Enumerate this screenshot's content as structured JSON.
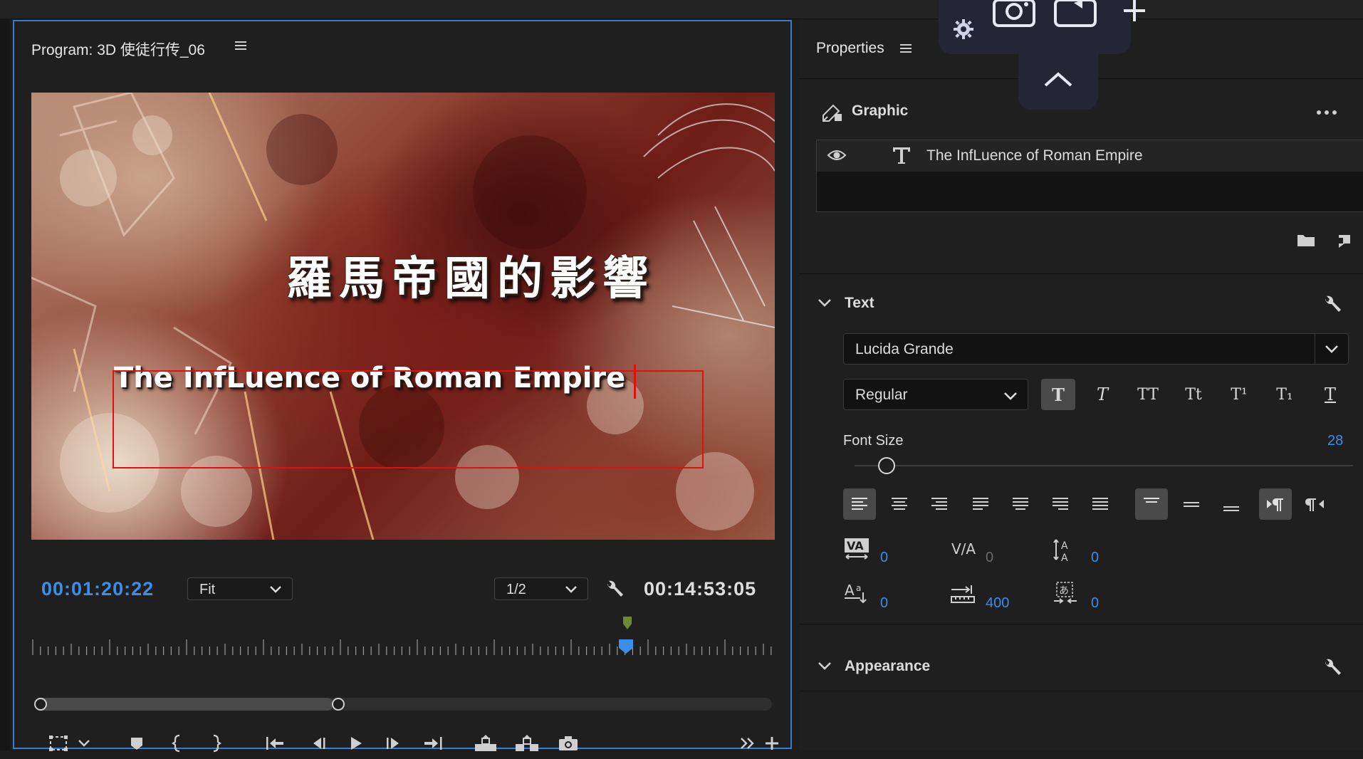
{
  "window": {
    "title": ""
  },
  "program_monitor": {
    "title": "Program: 3D 使徒行传_06",
    "overlay_chinese_title": "羅馬帝國的影響",
    "overlay_english_title": "The InfLuence of Roman Empire",
    "current_timecode": "00:01:20:22",
    "zoom_option": "Fit",
    "resolution_option": "1/2",
    "duration_timecode": "00:14:53:05"
  },
  "properties": {
    "title": "Properties",
    "graphic_label": "Graphic",
    "layer_name": "The InfLuence of Roman Empire",
    "text_section_label": "Text",
    "font_family": "Lucida Grande",
    "font_style": "Regular",
    "font_size_label": "Font Size",
    "font_size_value": "28",
    "font_size_level": 0.05,
    "tracking_value": "0",
    "kerning_value": "0",
    "leading_value": "0",
    "baseline_shift_value": "0",
    "tab_width_value": "400",
    "tsume_value": "0",
    "appearance_section_label": "Appearance",
    "format_buttons": [
      "T",
      "T",
      "TT",
      "Tt",
      "T¹",
      "T₁",
      "T"
    ]
  },
  "colors": {
    "accent_blue": "#3b8fe8",
    "selection_red": "#e01010",
    "panel_bg": "#1f1f1f",
    "panel_border_active": "#3a7bd0"
  }
}
